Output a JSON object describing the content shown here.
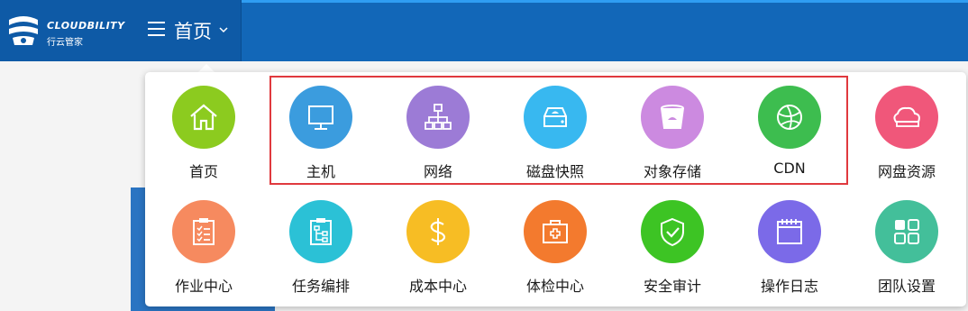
{
  "header": {
    "brand_name": "CLOUDBILITY",
    "brand_sub": "行云管家",
    "current_page": "首页"
  },
  "menu": {
    "row1": [
      {
        "label": "首页",
        "icon": "home-icon",
        "color": "#8ccb1f"
      },
      {
        "label": "主机",
        "icon": "monitor-icon",
        "color": "#3b9cde"
      },
      {
        "label": "网络",
        "icon": "network-icon",
        "color": "#9c7bd6"
      },
      {
        "label": "磁盘快照",
        "icon": "disk-icon",
        "color": "#38b8f0"
      },
      {
        "label": "对象存储",
        "icon": "bucket-icon",
        "color": "#cc8ae0"
      },
      {
        "label": "CDN",
        "icon": "globe-icon",
        "color": "#3dbd4f"
      },
      {
        "label": "网盘资源",
        "icon": "cloud-icon",
        "color": "#f0577a"
      }
    ],
    "row2": [
      {
        "label": "作业中心",
        "icon": "clipboard-list-icon",
        "color": "#f68a5f"
      },
      {
        "label": "任务编排",
        "icon": "clipboard-flow-icon",
        "color": "#2bc1d6"
      },
      {
        "label": "成本中心",
        "icon": "dollar-icon",
        "color": "#f7bd24"
      },
      {
        "label": "体检中心",
        "icon": "medkit-icon",
        "color": "#f37a2e"
      },
      {
        "label": "安全审计",
        "icon": "shield-check-icon",
        "color": "#3dc424"
      },
      {
        "label": "操作日志",
        "icon": "calendar-icon",
        "color": "#7b6ae8"
      },
      {
        "label": "团队设置",
        "icon": "grid-icon",
        "color": "#43bf9a"
      }
    ]
  }
}
